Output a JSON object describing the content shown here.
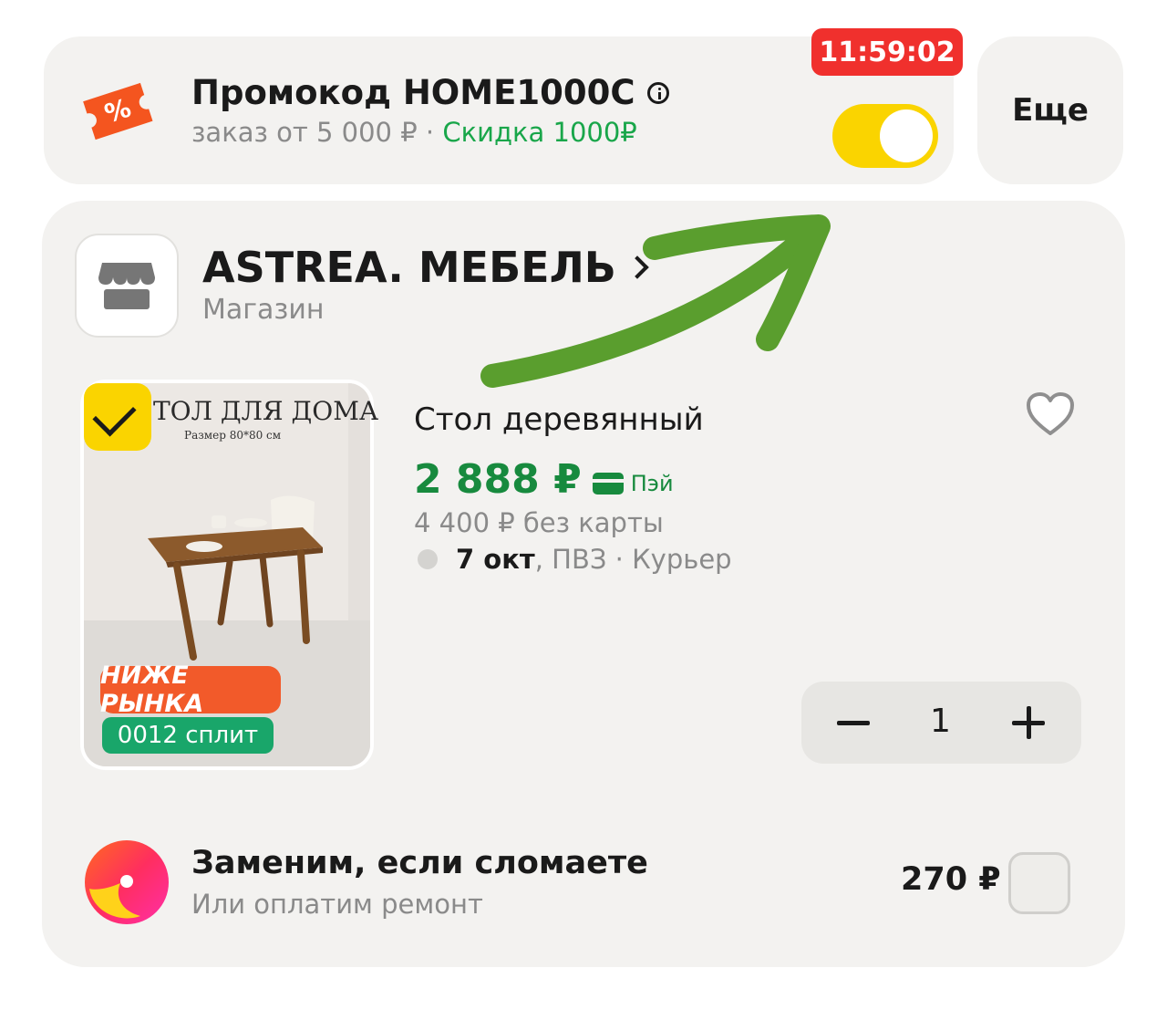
{
  "promo": {
    "title": "Промокод HOME1000C",
    "subtitle_gray": "заказ от 5 000 ₽ · ",
    "subtitle_green": "Скидка 1000₽",
    "timer": "11:59:02",
    "toggle_on": true,
    "more_label": "Еще",
    "icon": "percent-ticket-icon"
  },
  "shop": {
    "name": "ASTREA. МЕБЕЛЬ",
    "type": "Магазин",
    "icon": "store-icon"
  },
  "product": {
    "image_title": "ТОЛ ДЛЯ ДОМА",
    "image_subtitle": "Размер 80*80 см",
    "badge_low": "НИЖЕ РЫНКА",
    "badge_split": "0012 сплит",
    "name": "Стол деревянный",
    "price": "2 888 ₽",
    "pay_label": "Пэй",
    "old_price": "4 400 ₽ без карты",
    "delivery_date": "7 окт",
    "delivery_rest": ", ПВЗ · Курьер",
    "quantity": "1",
    "selected": true
  },
  "insurance": {
    "title": "Заменим, если сломаете",
    "subtitle": "Или оплатим ремонт",
    "price": "270 ₽",
    "checked": false
  },
  "colors": {
    "accent_yellow": "#fad400",
    "timer_red": "#f0302d",
    "price_green": "#178a3e",
    "annotation_arrow": "#5a9e2e"
  }
}
